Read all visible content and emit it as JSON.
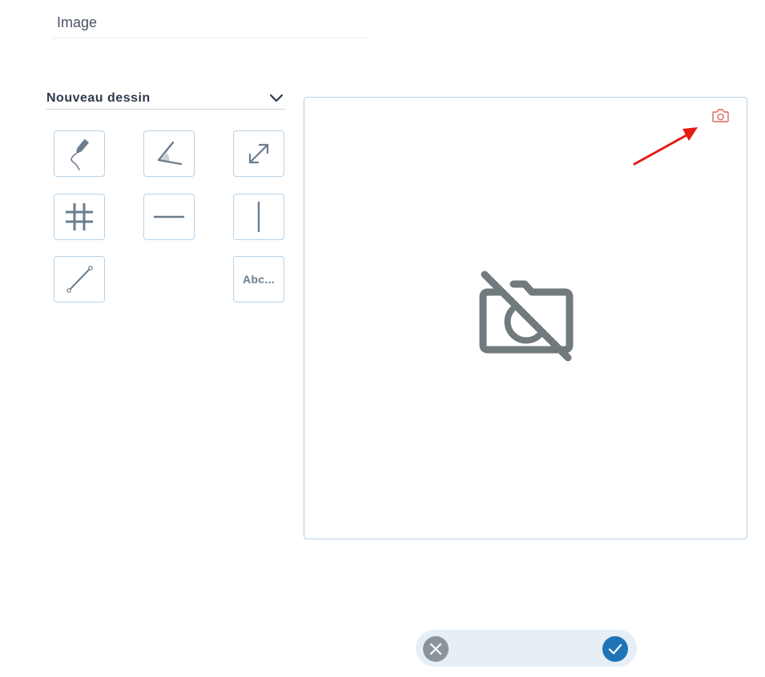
{
  "field": {
    "title": "Image"
  },
  "drawing_select": {
    "selected": "Nouveau dessin",
    "icon": "chevron-down-icon"
  },
  "tools": {
    "pencil": {
      "icon": "pencil-icon"
    },
    "angle": {
      "icon": "angle-icon"
    },
    "arrow": {
      "icon": "double-arrow-icon"
    },
    "grid": {
      "icon": "grid-icon"
    },
    "horizontal": {
      "icon": "horizontal-line-icon"
    },
    "vertical": {
      "icon": "vertical-line-icon"
    },
    "segment": {
      "icon": "segment-icon"
    },
    "text": {
      "label": "Abc..."
    }
  },
  "canvas": {
    "camera_icon": "camera-icon",
    "placeholder_icon": "no-camera-icon",
    "annotation": "red-arrow"
  },
  "colors": {
    "accent": "#1f74b5",
    "tool_border": "#b6d2ea",
    "icon": "#6b7d8c",
    "camera": "#e0665c",
    "annotation": "#e41b13",
    "cancel": "#8b939c"
  },
  "actions": {
    "cancel": "close-icon",
    "confirm": "check-icon"
  }
}
